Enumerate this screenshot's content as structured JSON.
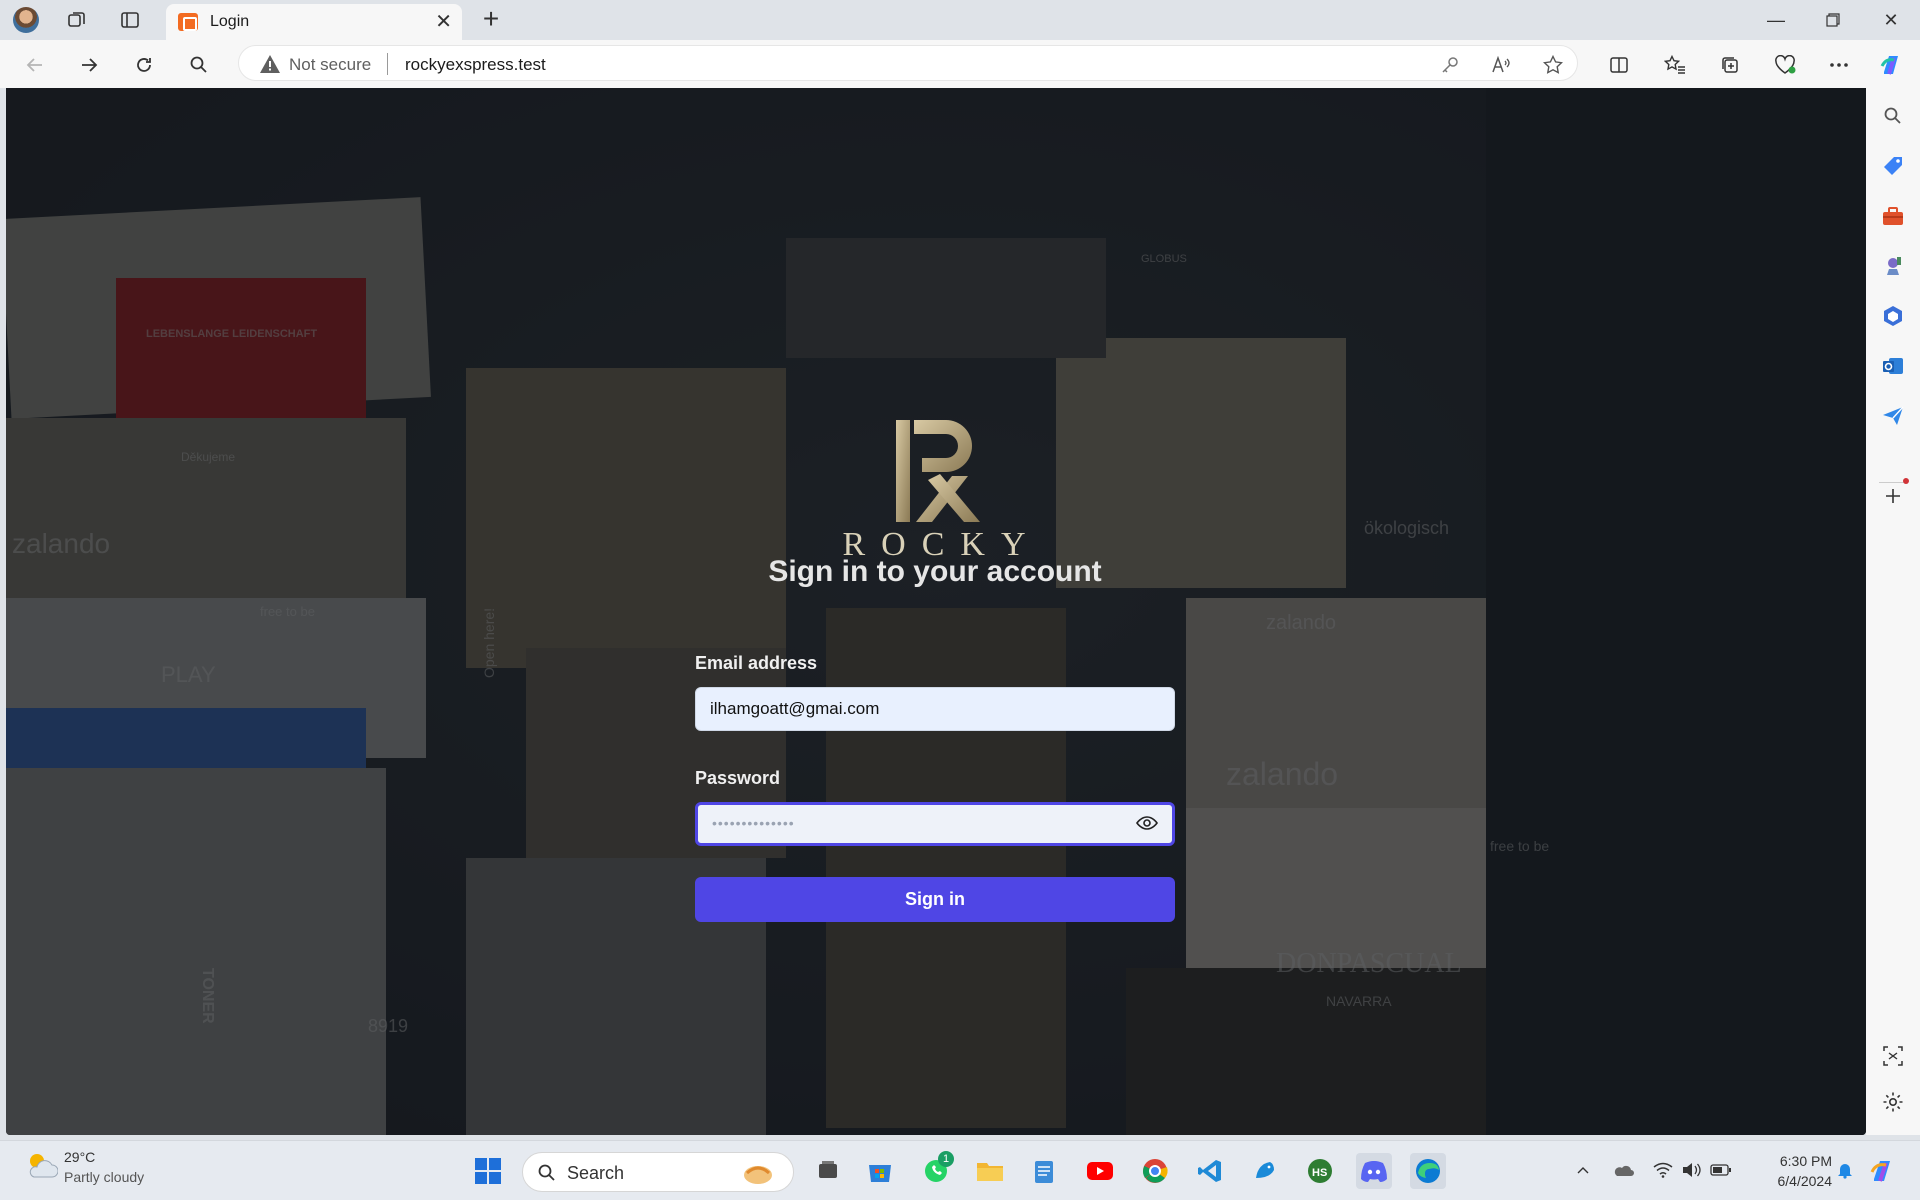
{
  "browser": {
    "tab_title": "Login",
    "address": {
      "security_label": "Not secure",
      "url": "rockyexspress.test"
    }
  },
  "page": {
    "brand": "ROCKY",
    "heading": "Sign in to your account",
    "email": {
      "label": "Email address",
      "value": "ilhamgoatt@gmai.com"
    },
    "password": {
      "label": "Password",
      "masked_value": "••••••••••••••"
    },
    "submit_label": "Sign in",
    "background_text": [
      "zalando",
      "zalando",
      "zalando",
      "LEBENSLANGE LEIDENSCHAFT",
      "Děkujeme",
      "DONPASCUAL",
      "NAVARRA",
      "GLOBUS",
      "PLAY",
      "free to be",
      "free to be",
      "Open here!",
      "ökologisch",
      "TONER",
      "8919"
    ]
  },
  "taskbar": {
    "weather_temp": "29°C",
    "weather_condition": "Partly cloudy",
    "search_label": "Search",
    "whatsapp_badge": "1",
    "time": "6:30 PM",
    "date": "6/4/2024"
  },
  "colors": {
    "primary": "#4f46e5",
    "input_bg": "#e8f0fe"
  }
}
